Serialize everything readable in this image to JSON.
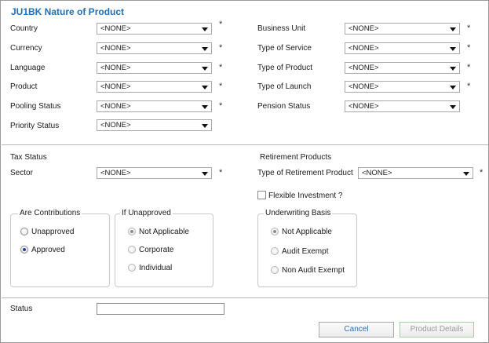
{
  "title": "JU1BK Nature of Product",
  "required_mark": "*",
  "none_option": "<NONE>",
  "fields": {
    "country": "Country",
    "currency": "Currency",
    "language": "Language",
    "product": "Product",
    "pooling_status": "Pooling Status",
    "priority_status": "Priority Status",
    "business_unit": "Business Unit",
    "type_of_service": "Type of Service",
    "type_of_product": "Type of Product",
    "type_of_launch": "Type of Launch",
    "pension_status": "Pension Status"
  },
  "tax_status": {
    "heading": "Tax Status",
    "sector": "Sector"
  },
  "retirement": {
    "heading": "Retirement Products",
    "type_label": "Type of Retirement Product",
    "flexible_investment": "Flexible Investment ?",
    "flexible_investment_checked": false
  },
  "contributions": {
    "legend": "Are Contributions",
    "options": [
      "Unapproved",
      "Approved"
    ],
    "selected": "Approved"
  },
  "if_unapproved": {
    "legend": "If Unapproved",
    "options": [
      "Not Applicable",
      "Corporate",
      "Individual"
    ],
    "selected": "Not Applicable",
    "disabled": true
  },
  "underwriting": {
    "legend": "Underwriting Basis",
    "options": [
      "Not Applicable",
      "Audit Exempt",
      "Non Audit Exempt"
    ],
    "selected": "Not Applicable",
    "disabled": true
  },
  "status": {
    "label": "Status",
    "value": ""
  },
  "buttons": {
    "cancel": "Cancel",
    "product_details": "Product Details"
  }
}
